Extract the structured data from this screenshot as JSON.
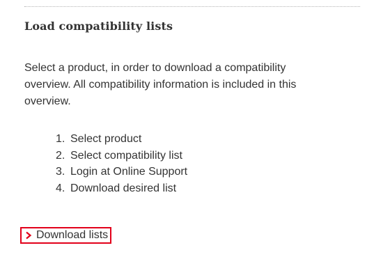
{
  "section": {
    "title": "Load compatibility lists",
    "description": "Select a product, in order to download a compatibility overview. All compatibility information is included in this overview.",
    "steps": [
      {
        "number": "1.",
        "label": "Select product"
      },
      {
        "number": "2.",
        "label": "Select compatibility list"
      },
      {
        "number": "3.",
        "label": "Login at Online Support"
      },
      {
        "number": "4.",
        "label": "Download desired list"
      }
    ],
    "download_link": {
      "label": "Download lists",
      "icon": "chevron-right-icon"
    }
  },
  "colors": {
    "text": "#333333",
    "highlight_border": "#e2001a",
    "chevron": "#e2001a",
    "divider": "#b3b3b3"
  }
}
